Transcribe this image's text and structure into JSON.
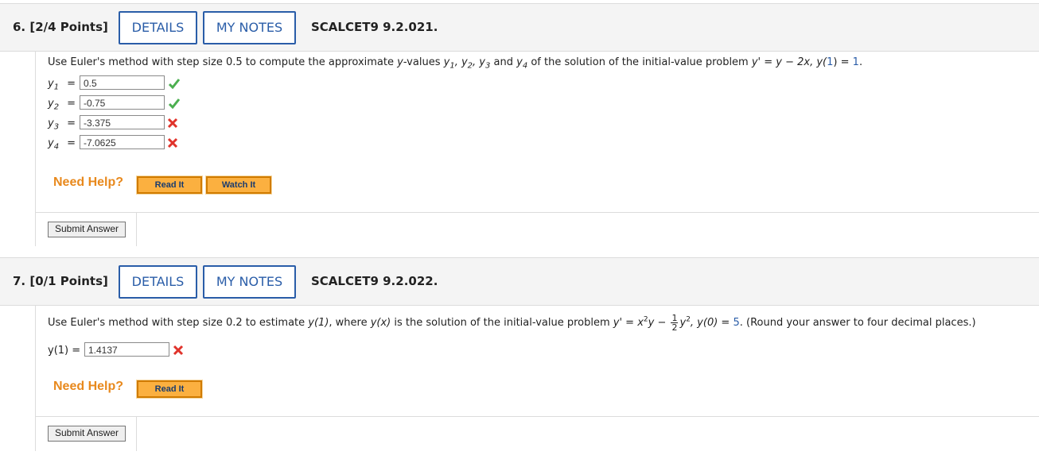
{
  "q6": {
    "number": "6.",
    "points": "[2/4 Points]",
    "details_label": "DETAILS",
    "mynotes_label": "MY NOTES",
    "code": "SCALCET9 9.2.021.",
    "prompt_a": "Use Euler's method with step size 0.5 to compute the approximate ",
    "prompt_y": "y",
    "prompt_b": "-values ",
    "prompt_c": " and ",
    "prompt_d": " of the solution of the initial-value problem ",
    "prompt_eq": "y' = y − 2x, y(",
    "prompt_one": "1",
    "prompt_eq2": ") = ",
    "prompt_val": "1",
    "prompt_end": ".",
    "answers": [
      {
        "label": "y",
        "sub": "1",
        "value": "0.5",
        "correct": true
      },
      {
        "label": "y",
        "sub": "2",
        "value": "-0.75",
        "correct": true
      },
      {
        "label": "y",
        "sub": "3",
        "value": "-3.375",
        "correct": false
      },
      {
        "label": "y",
        "sub": "4",
        "value": "-7.0625",
        "correct": false
      }
    ],
    "need_help": "Need Help?",
    "read_it": "Read It",
    "watch_it": "Watch It",
    "submit": "Submit Answer"
  },
  "q7": {
    "number": "7.",
    "points": "[0/1 Points]",
    "details_label": "DETAILS",
    "mynotes_label": "MY NOTES",
    "code": "SCALCET9 9.2.022.",
    "prompt_a": "Use Euler's method with step size 0.2 to estimate ",
    "prompt_y1": "y(1)",
    "prompt_b": ", where ",
    "prompt_yx": "y(x)",
    "prompt_c": " is the solution of the initial-value problem ",
    "prompt_eq": "y' = x",
    "prompt_y": "y − ",
    "frac_num": "1",
    "frac_den": "2",
    "prompt_y2": "y",
    "prompt_y0": ", y(0) = ",
    "prompt_val": "5",
    "prompt_end": ". (Round your answer to four decimal places.)",
    "answer_label": "y(1) = ",
    "answer_value": "1.4137",
    "correct": false,
    "need_help": "Need Help?",
    "read_it": "Read It",
    "submit": "Submit Answer"
  },
  "colors": {
    "accent": "#2a5da8",
    "help": "#e8891d",
    "correct": "#4caf50",
    "incorrect": "#e0332b"
  },
  "icons": {
    "correct": "check-icon",
    "incorrect": "x-icon"
  }
}
